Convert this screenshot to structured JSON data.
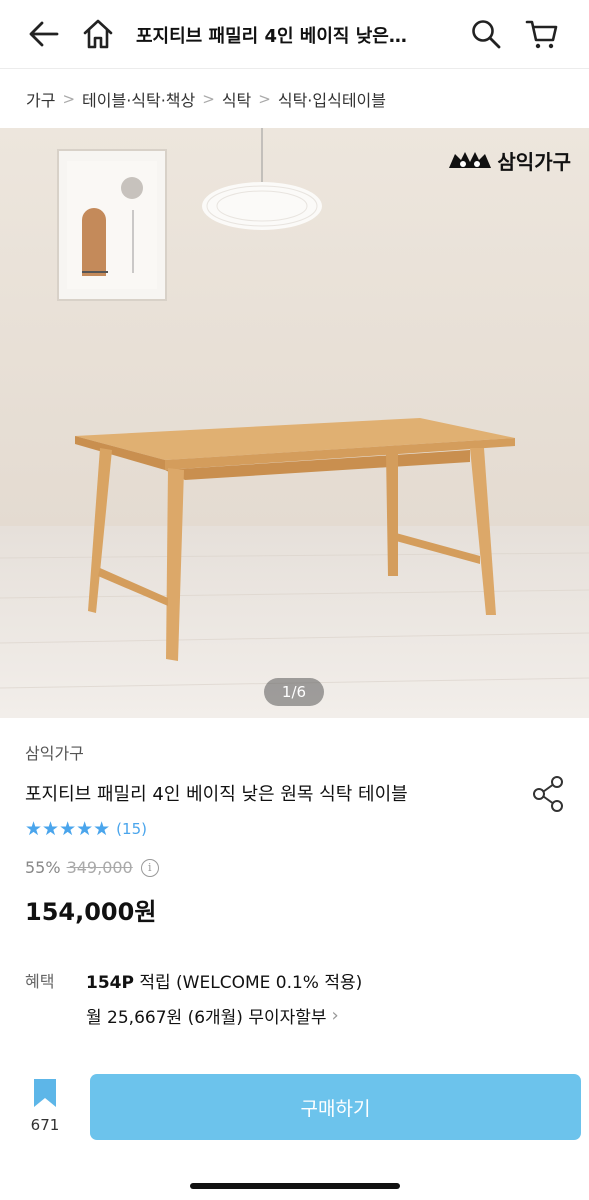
{
  "header": {
    "title": "포지티브 패밀리 4인 베이직 낮은…",
    "icons": [
      "back-arrow-icon",
      "home-icon",
      "search-icon",
      "cart-icon"
    ]
  },
  "breadcrumb": [
    "가구",
    "테이블·식탁·책상",
    "식탁",
    "식탁·입식테이블"
  ],
  "image": {
    "brand_logo_text": "삼익가구",
    "counter": "1/6"
  },
  "product": {
    "brand": "삼익가구",
    "title": "포지티브 패밀리 4인 베이직 낮은 원목 식탁 테이블",
    "rating": 5,
    "review_count": "(15)",
    "discount": "55%",
    "original_price": "349,000",
    "sale_price": "154,000원"
  },
  "benefits": {
    "label": "혜택",
    "points": "154P",
    "points_text": " 적립 (WELCOME 0.1% 적용)",
    "installment": "월 25,667원 (6개월) 무이자할부"
  },
  "bottom": {
    "bookmark_count": "671",
    "buy_label": "구매하기"
  },
  "colors": {
    "accent": "#6cc3ec",
    "star": "#4aa5ec"
  }
}
